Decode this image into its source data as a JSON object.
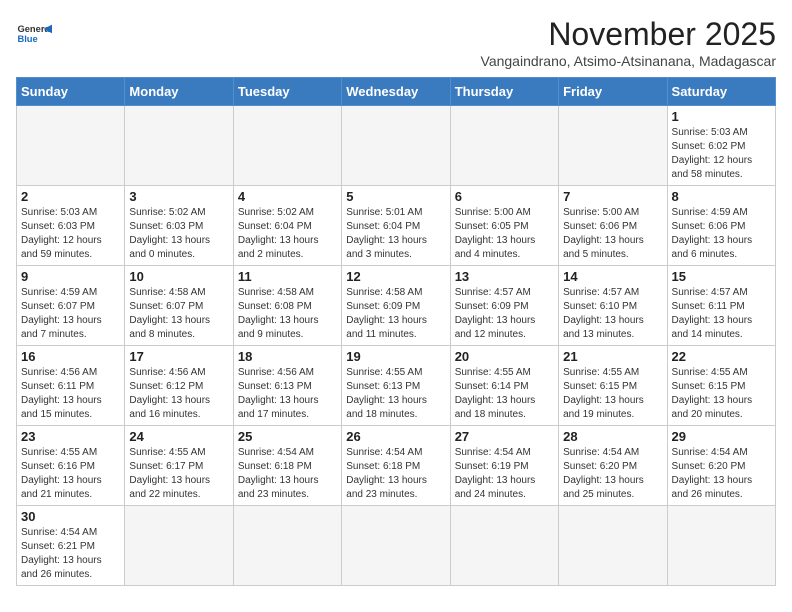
{
  "header": {
    "logo_general": "General",
    "logo_blue": "Blue",
    "month": "November 2025",
    "location": "Vangaindrano, Atsimo-Atsinanana, Madagascar"
  },
  "weekdays": [
    "Sunday",
    "Monday",
    "Tuesday",
    "Wednesday",
    "Thursday",
    "Friday",
    "Saturday"
  ],
  "weeks": [
    [
      {
        "day": "",
        "info": ""
      },
      {
        "day": "",
        "info": ""
      },
      {
        "day": "",
        "info": ""
      },
      {
        "day": "",
        "info": ""
      },
      {
        "day": "",
        "info": ""
      },
      {
        "day": "",
        "info": ""
      },
      {
        "day": "1",
        "info": "Sunrise: 5:03 AM\nSunset: 6:02 PM\nDaylight: 12 hours and 58 minutes."
      }
    ],
    [
      {
        "day": "2",
        "info": "Sunrise: 5:03 AM\nSunset: 6:03 PM\nDaylight: 12 hours and 59 minutes."
      },
      {
        "day": "3",
        "info": "Sunrise: 5:02 AM\nSunset: 6:03 PM\nDaylight: 13 hours and 0 minutes."
      },
      {
        "day": "4",
        "info": "Sunrise: 5:02 AM\nSunset: 6:04 PM\nDaylight: 13 hours and 2 minutes."
      },
      {
        "day": "5",
        "info": "Sunrise: 5:01 AM\nSunset: 6:04 PM\nDaylight: 13 hours and 3 minutes."
      },
      {
        "day": "6",
        "info": "Sunrise: 5:00 AM\nSunset: 6:05 PM\nDaylight: 13 hours and 4 minutes."
      },
      {
        "day": "7",
        "info": "Sunrise: 5:00 AM\nSunset: 6:06 PM\nDaylight: 13 hours and 5 minutes."
      },
      {
        "day": "8",
        "info": "Sunrise: 4:59 AM\nSunset: 6:06 PM\nDaylight: 13 hours and 6 minutes."
      }
    ],
    [
      {
        "day": "9",
        "info": "Sunrise: 4:59 AM\nSunset: 6:07 PM\nDaylight: 13 hours and 7 minutes."
      },
      {
        "day": "10",
        "info": "Sunrise: 4:58 AM\nSunset: 6:07 PM\nDaylight: 13 hours and 8 minutes."
      },
      {
        "day": "11",
        "info": "Sunrise: 4:58 AM\nSunset: 6:08 PM\nDaylight: 13 hours and 9 minutes."
      },
      {
        "day": "12",
        "info": "Sunrise: 4:58 AM\nSunset: 6:09 PM\nDaylight: 13 hours and 11 minutes."
      },
      {
        "day": "13",
        "info": "Sunrise: 4:57 AM\nSunset: 6:09 PM\nDaylight: 13 hours and 12 minutes."
      },
      {
        "day": "14",
        "info": "Sunrise: 4:57 AM\nSunset: 6:10 PM\nDaylight: 13 hours and 13 minutes."
      },
      {
        "day": "15",
        "info": "Sunrise: 4:57 AM\nSunset: 6:11 PM\nDaylight: 13 hours and 14 minutes."
      }
    ],
    [
      {
        "day": "16",
        "info": "Sunrise: 4:56 AM\nSunset: 6:11 PM\nDaylight: 13 hours and 15 minutes."
      },
      {
        "day": "17",
        "info": "Sunrise: 4:56 AM\nSunset: 6:12 PM\nDaylight: 13 hours and 16 minutes."
      },
      {
        "day": "18",
        "info": "Sunrise: 4:56 AM\nSunset: 6:13 PM\nDaylight: 13 hours and 17 minutes."
      },
      {
        "day": "19",
        "info": "Sunrise: 4:55 AM\nSunset: 6:13 PM\nDaylight: 13 hours and 18 minutes."
      },
      {
        "day": "20",
        "info": "Sunrise: 4:55 AM\nSunset: 6:14 PM\nDaylight: 13 hours and 18 minutes."
      },
      {
        "day": "21",
        "info": "Sunrise: 4:55 AM\nSunset: 6:15 PM\nDaylight: 13 hours and 19 minutes."
      },
      {
        "day": "22",
        "info": "Sunrise: 4:55 AM\nSunset: 6:15 PM\nDaylight: 13 hours and 20 minutes."
      }
    ],
    [
      {
        "day": "23",
        "info": "Sunrise: 4:55 AM\nSunset: 6:16 PM\nDaylight: 13 hours and 21 minutes."
      },
      {
        "day": "24",
        "info": "Sunrise: 4:55 AM\nSunset: 6:17 PM\nDaylight: 13 hours and 22 minutes."
      },
      {
        "day": "25",
        "info": "Sunrise: 4:54 AM\nSunset: 6:18 PM\nDaylight: 13 hours and 23 minutes."
      },
      {
        "day": "26",
        "info": "Sunrise: 4:54 AM\nSunset: 6:18 PM\nDaylight: 13 hours and 23 minutes."
      },
      {
        "day": "27",
        "info": "Sunrise: 4:54 AM\nSunset: 6:19 PM\nDaylight: 13 hours and 24 minutes."
      },
      {
        "day": "28",
        "info": "Sunrise: 4:54 AM\nSunset: 6:20 PM\nDaylight: 13 hours and 25 minutes."
      },
      {
        "day": "29",
        "info": "Sunrise: 4:54 AM\nSunset: 6:20 PM\nDaylight: 13 hours and 26 minutes."
      }
    ],
    [
      {
        "day": "30",
        "info": "Sunrise: 4:54 AM\nSunset: 6:21 PM\nDaylight: 13 hours and 26 minutes."
      },
      {
        "day": "",
        "info": ""
      },
      {
        "day": "",
        "info": ""
      },
      {
        "day": "",
        "info": ""
      },
      {
        "day": "",
        "info": ""
      },
      {
        "day": "",
        "info": ""
      },
      {
        "day": "",
        "info": ""
      }
    ]
  ]
}
